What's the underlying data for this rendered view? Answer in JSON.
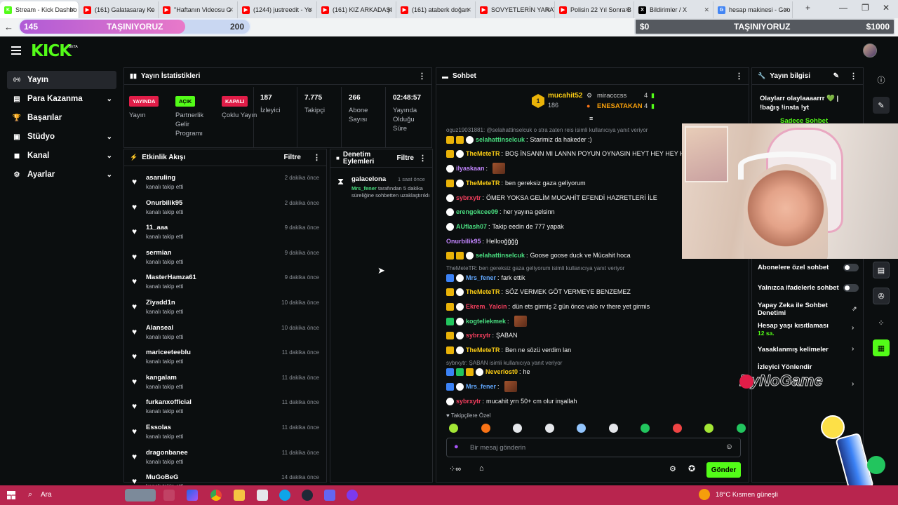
{
  "browser": {
    "tabs": [
      {
        "title": "Stream - Kick Dashbo",
        "fav": "#53fc18",
        "favtxt": "K"
      },
      {
        "title": "(161) Galatasaray Ko",
        "fav": "#ff0000",
        "favtxt": "▶"
      },
      {
        "title": "\"Haftanın Videosu G",
        "fav": "#ff0000",
        "favtxt": "▶"
      },
      {
        "title": "(1244) justreedit - Yo",
        "fav": "#ff0000",
        "favtxt": "▶"
      },
      {
        "title": "(161) KIZ ARKADAŞI",
        "fav": "#ff0000",
        "favtxt": "▶"
      },
      {
        "title": "(161) ataberk doğan",
        "fav": "#ff0000",
        "favtxt": "▶"
      },
      {
        "title": "SOVYETLERİN YARAT",
        "fav": "#ff0000",
        "favtxt": "▶"
      },
      {
        "title": "Polisin 22 Yıl Sonra B",
        "fav": "#ff0000",
        "favtxt": "▶"
      },
      {
        "title": "Bildirimler / X",
        "fav": "#000000",
        "favtxt": "X"
      },
      {
        "title": "hesap makinesi - Goo",
        "fav": "#4285f4",
        "favtxt": "G"
      }
    ]
  },
  "overlay": {
    "left_count": "145",
    "left_text": "TAŞINIYORUZ",
    "left_goal": "200",
    "left_progress": 0.72,
    "right_start": "$0",
    "right_text": "TAŞINIYORUZ",
    "right_goal": "$1000"
  },
  "logo": "KICK",
  "logo_tag": "BETA",
  "sidebar": {
    "items": [
      {
        "label": "Yayın",
        "icon": "broadcast-icon",
        "glyph": "((•))",
        "chev": false
      },
      {
        "label": "Para Kazanma",
        "icon": "money-icon",
        "glyph": "▤",
        "chev": true
      },
      {
        "label": "Başarılar",
        "icon": "trophy-icon",
        "glyph": "🏆",
        "chev": false
      },
      {
        "label": "Stüdyo",
        "icon": "studio-icon",
        "glyph": "▣",
        "chev": true
      },
      {
        "label": "Kanal",
        "icon": "channel-icon",
        "glyph": "◼",
        "chev": true
      },
      {
        "label": "Ayarlar",
        "icon": "gear-icon",
        "glyph": "⚙",
        "chev": true
      }
    ]
  },
  "stats": {
    "title": "Yayın İstatistikleri",
    "badges": [
      {
        "badge": "YAYINDA",
        "label": "Yayın",
        "color": "#e11d48"
      },
      {
        "badge": "AÇIK",
        "label": "Partnerlik Gelir Programı",
        "color": "#53fc18"
      },
      {
        "badge": "KAPALI",
        "label": "Çoklu Yayın",
        "color": "#e11d48"
      }
    ],
    "numbers": [
      {
        "value": "187",
        "label": "İzleyici"
      },
      {
        "value": "7.775",
        "label": "Takipçi"
      },
      {
        "value": "266",
        "label": "Abone Sayısı"
      },
      {
        "value": "02:48:57",
        "label": "Yayında Olduğu Süre"
      }
    ]
  },
  "activity": {
    "title": "Etkinlik Akışı",
    "filter": "Filtre",
    "sub": "kanalı takip etti",
    "events": [
      {
        "name": "asaruling",
        "time": "2 dakika önce"
      },
      {
        "name": "Onurbilik95",
        "time": "2 dakika önce"
      },
      {
        "name": "11_aaa",
        "time": "9 dakika önce"
      },
      {
        "name": "sermian",
        "time": "9 dakika önce"
      },
      {
        "name": "MasterHamza61",
        "time": "9 dakika önce"
      },
      {
        "name": "Ziyadd1n",
        "time": "10 dakika önce"
      },
      {
        "name": "Alanseal",
        "time": "10 dakika önce"
      },
      {
        "name": "mariceeteeblu",
        "time": "11 dakika önce"
      },
      {
        "name": "kangalam",
        "time": "11 dakika önce"
      },
      {
        "name": "furkanxofficial",
        "time": "11 dakika önce"
      },
      {
        "name": "Essolas",
        "time": "11 dakika önce"
      },
      {
        "name": "dragonbanee",
        "time": "11 dakika önce"
      },
      {
        "name": "MuGoBeG",
        "time": "14 dakika önce"
      }
    ]
  },
  "moderation": {
    "title": "Denetim Eylemleri",
    "filter": "Filtre",
    "user": "galacelona",
    "time": "1 saat önce",
    "by": "Mrs_fener",
    "desc": "tarafından 5 dakika süreliğine sohbetten uzaklaştırıldı"
  },
  "chat": {
    "title": "Sohbet",
    "top1_name": "mucahit52",
    "top1_count": "186",
    "top1_rank": "1",
    "top2_name": "miracccss",
    "top2_count": "4",
    "top3_name": "ENESATAKAN",
    "top3_count": "4",
    "reply1": "oguz19031881: @selahattinselcuk o stra zaten reis isimli kullanıcıya yanıt veriyor",
    "reply2": "TheMeteTR: ben gereksiz gaza geliyorum isimli kullanıcıya yanıt veriyor",
    "reply3": "sybrxytr: ŞABAN isimli kullanıcıya yanıt veriyor",
    "messages": [
      {
        "user": "selahattinselcuk",
        "text": "Starimiz da hakeder :)",
        "color": "#4ade80"
      },
      {
        "user": "TheMeteTR",
        "text": "BOŞ İNSANN MI LANNN POYUN OYNASIN HEYT HEY HEY HEYT",
        "color": "#facc15"
      },
      {
        "user": "ilyaskaan",
        "text": "",
        "color": "#c084fc"
      },
      {
        "user": "TheMeteTR",
        "text": "ben gereksiz gaza geliyorum",
        "color": "#facc15"
      },
      {
        "user": "sybrxytr",
        "text": "ÖMER YOKSA GELİM MUCAHİT EFENDİ HAZRETLERİ İLE",
        "color": "#f43f5e"
      },
      {
        "user": "erengokcee09",
        "text": "her yayına gelsinn",
        "color": "#4ade80"
      },
      {
        "user": "AUflash07",
        "text": "Takip eedin de 777 yapak",
        "color": "#4ade80"
      },
      {
        "user": "Onurbilik95",
        "text": "Hellooğğğğ",
        "color": "#c084fc"
      },
      {
        "user": "selahattinselcuk",
        "text": "Goose goose duck ve Mücahit hoca",
        "color": "#4ade80"
      },
      {
        "user": "Mrs_fener",
        "text": "fark ettik",
        "color": "#60a5fa"
      },
      {
        "user": "TheMeteTR",
        "text": "SÖZ VERMEK GÖT VERMEYE BENZEMEZ",
        "color": "#facc15"
      },
      {
        "user": "Ekrem_Yalcin",
        "text": "dün ets girmiş 2 gün önce valo rv there yet girmis",
        "color": "#f43f5e"
      },
      {
        "user": "kogteliekmek",
        "text": "",
        "color": "#4ade80"
      },
      {
        "user": "sybrxytr",
        "text": "ŞABAN",
        "color": "#f43f5e"
      },
      {
        "user": "TheMeteTR",
        "text": "Ben ne sözü verdim lan",
        "color": "#facc15"
      },
      {
        "user": "Neverlost0",
        "text": "he",
        "color": "#facc15"
      },
      {
        "user": "Mrs_fener",
        "text": "",
        "color": "#60a5fa"
      },
      {
        "user": "sybrxytr",
        "text": "mucahit yrn 50+ cm olur inşallah",
        "color": "#f43f5e"
      }
    ],
    "followers_only": "Takipçilere Özel",
    "placeholder": "Bir mesaj gönderin",
    "send": "Gönder"
  },
  "info": {
    "title": "Yayın bilgisi",
    "stream_title": "Olaylarr olaylaaaarrr 💚 | !bağış !insta !yt",
    "sub_chat": "Sadece Sohbet",
    "options": [
      {
        "label": "Abonelere özel sohbet"
      },
      {
        "label": "Yalnızca ifadelerle sohbet"
      }
    ],
    "ai_label": "Yapay Zeka ile Sohbet Denetimi",
    "age_label": "Hesap yaşı kısıtlaması",
    "age_value": "12 sa.",
    "banned_label": "Yasaklanmış kelimeler",
    "viewer_label": "İzleyici Yönlendir",
    "watermark": "ByNoGame"
  },
  "taskbar": {
    "search": "Ara",
    "weather": "18°C  Kısmen güneşli"
  }
}
